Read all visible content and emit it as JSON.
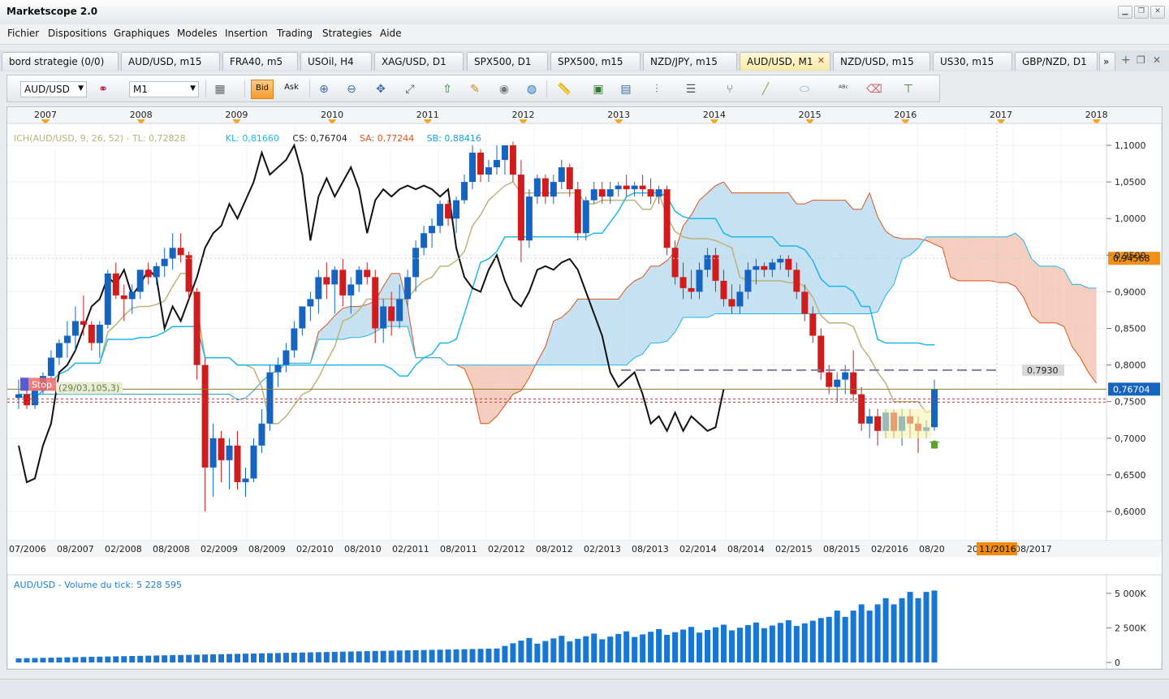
{
  "app": {
    "title": "Marketscope 2.0"
  },
  "window_buttons": [
    {
      "name": "minimize",
      "glyph": "▁"
    },
    {
      "name": "restore",
      "glyph": "❐"
    },
    {
      "name": "close",
      "glyph": "✕"
    }
  ],
  "menu": [
    "Fichier",
    "Dispositions",
    "Graphiques",
    "Modeles",
    "Insertion",
    "Trading",
    "Strategies",
    "Aide"
  ],
  "tabs": [
    {
      "label": "bord strategie (0/0)"
    },
    {
      "label": "AUD/USD, m15"
    },
    {
      "label": "FRA40, m5"
    },
    {
      "label": "USOil, H4"
    },
    {
      "label": "XAG/USD, D1"
    },
    {
      "label": "SPX500, D1"
    },
    {
      "label": "SPX500, m15"
    },
    {
      "label": "NZD/JPY, m15"
    },
    {
      "label": "AUD/USD, M1",
      "active": true
    },
    {
      "label": "NZD/USD, m15"
    },
    {
      "label": "US30, m15"
    },
    {
      "label": "GBP/NZD, D1"
    }
  ],
  "tab_controls": {
    "overflow": "»",
    "add": "+",
    "float": "❐",
    "close": "✕"
  },
  "toolbar": {
    "instrument": "AUD/USD",
    "timeframe": "M1",
    "bid_label": "Bid",
    "ask_label": "Ask",
    "icons": [
      "chart-type-icon",
      "crosshair-icon",
      "zoom-in-icon",
      "zoom-out-icon",
      "move-icon",
      "fit-icon",
      "cursor-icon",
      "properties-icon",
      "eye-icon",
      "globe-icon",
      "ruler-icon",
      "image-icon",
      "template-icon",
      "indicators-icon",
      "lines-icon",
      "pitchfork-icon",
      "pen-icon",
      "ellipse-icon",
      "text-icon",
      "eraser-icon",
      "hierarchy-icon"
    ]
  },
  "chart": {
    "top_years": [
      "2007",
      "2008",
      "2009",
      "2010",
      "2011",
      "2012",
      "2013",
      "2014",
      "2015",
      "2016",
      "2017",
      "2018"
    ],
    "indicator_header": [
      {
        "text": "ICH(AUD/USD, 9, 26, 52) -  TL: 0,72828",
        "color": "#b5b37a"
      },
      {
        "text": "KL: 0,81660",
        "color": "#1fb6e8"
      },
      {
        "text": "CS: 0,76704",
        "color": "#222222"
      },
      {
        "text": "SA: 0,77244",
        "color": "#d9541e"
      },
      {
        "text": "SB: 0,88416",
        "color": "#1a9fd6"
      }
    ],
    "price_ticks": [
      "1,1000",
      "1,0500",
      "1,0000",
      "0,9500",
      "0,9000",
      "0,8500",
      "0,8000",
      "0,7500",
      "0,7000",
      "0,6500",
      "0,6000"
    ],
    "current_price_label": "0,76704",
    "current_price": 0.76704,
    "marker_price_label": "0,94568",
    "marker_price": 0.94568,
    "level_label": "0.7930",
    "level_price": 0.793,
    "stop_label": "Stop",
    "stop_info": "(29/03,105,3)",
    "x_labels": [
      "07/2006",
      "08/2007",
      "02/2008",
      "08/2008",
      "02/2009",
      "08/2009",
      "02/2010",
      "08/2010",
      "02/2011",
      "08/2011",
      "02/2012",
      "08/2012",
      "02/2013",
      "08/2013",
      "02/2014",
      "08/2014",
      "02/2015",
      "08/2015",
      "02/2016",
      "08/20",
      "2017",
      "08/2017"
    ],
    "x_highlight": "11/2016",
    "volume_header": "AUD/USD - Volume du tick: 5 228 595",
    "volume_ticks": [
      "5 000K",
      "2 500K",
      "0"
    ],
    "colors": {
      "bull": "#1565c0",
      "bear": "#d01c1c",
      "kumo_bull": "#bcdcef",
      "kumo_bear": "#f3c6b4",
      "tenkan": "#bdb37a",
      "kijun": "#1fb6e8",
      "chikou": "#111111",
      "spanA": "#d9541e",
      "volume": "#1976d2",
      "price_flag": "#1565c0",
      "marker_flag": "#f0901a"
    }
  },
  "chart_data": {
    "type": "candlestick",
    "symbol": "AUD/USD",
    "timeframe": "M1",
    "x_range": [
      "07/2006",
      "08/2017"
    ],
    "ylim": [
      0.58,
      1.11
    ],
    "indicator": {
      "name": "ICH(AUD/USD, 9, 26, 52)",
      "TL": 0.72828,
      "KL": 0.8166,
      "CS": 0.76704,
      "SA": 0.77244,
      "SB": 0.88416
    },
    "candles": [
      [
        0.755,
        0.78,
        0.74,
        0.76
      ],
      [
        0.76,
        0.77,
        0.74,
        0.745
      ],
      [
        0.745,
        0.77,
        0.74,
        0.765
      ],
      [
        0.765,
        0.79,
        0.76,
        0.785
      ],
      [
        0.785,
        0.82,
        0.78,
        0.81
      ],
      [
        0.81,
        0.835,
        0.8,
        0.83
      ],
      [
        0.83,
        0.86,
        0.81,
        0.84
      ],
      [
        0.84,
        0.88,
        0.82,
        0.86
      ],
      [
        0.86,
        0.895,
        0.84,
        0.855
      ],
      [
        0.855,
        0.86,
        0.82,
        0.83
      ],
      [
        0.83,
        0.86,
        0.81,
        0.855
      ],
      [
        0.855,
        0.93,
        0.85,
        0.925
      ],
      [
        0.925,
        0.94,
        0.89,
        0.895
      ],
      [
        0.895,
        0.91,
        0.86,
        0.89
      ],
      [
        0.89,
        0.91,
        0.87,
        0.9
      ],
      [
        0.9,
        0.93,
        0.89,
        0.93
      ],
      [
        0.93,
        0.94,
        0.91,
        0.92
      ],
      [
        0.92,
        0.94,
        0.91,
        0.935
      ],
      [
        0.935,
        0.96,
        0.92,
        0.945
      ],
      [
        0.945,
        0.98,
        0.93,
        0.96
      ],
      [
        0.96,
        0.98,
        0.94,
        0.95
      ],
      [
        0.95,
        0.955,
        0.89,
        0.9
      ],
      [
        0.9,
        0.905,
        0.78,
        0.8
      ],
      [
        0.8,
        0.81,
        0.6,
        0.66
      ],
      [
        0.66,
        0.72,
        0.62,
        0.7
      ],
      [
        0.7,
        0.71,
        0.64,
        0.67
      ],
      [
        0.67,
        0.7,
        0.63,
        0.69
      ],
      [
        0.69,
        0.71,
        0.63,
        0.64
      ],
      [
        0.64,
        0.66,
        0.62,
        0.645
      ],
      [
        0.645,
        0.7,
        0.64,
        0.69
      ],
      [
        0.69,
        0.74,
        0.68,
        0.72
      ],
      [
        0.72,
        0.8,
        0.71,
        0.79
      ],
      [
        0.79,
        0.81,
        0.77,
        0.8
      ],
      [
        0.8,
        0.83,
        0.79,
        0.82
      ],
      [
        0.82,
        0.86,
        0.81,
        0.85
      ],
      [
        0.85,
        0.88,
        0.84,
        0.88
      ],
      [
        0.88,
        0.9,
        0.86,
        0.89
      ],
      [
        0.89,
        0.93,
        0.87,
        0.92
      ],
      [
        0.92,
        0.94,
        0.89,
        0.91
      ],
      [
        0.91,
        0.935,
        0.87,
        0.93
      ],
      [
        0.93,
        0.945,
        0.88,
        0.895
      ],
      [
        0.895,
        0.92,
        0.87,
        0.91
      ],
      [
        0.91,
        0.935,
        0.9,
        0.93
      ],
      [
        0.93,
        0.94,
        0.91,
        0.92
      ],
      [
        0.92,
        0.93,
        0.83,
        0.85
      ],
      [
        0.85,
        0.89,
        0.83,
        0.88
      ],
      [
        0.88,
        0.9,
        0.84,
        0.86
      ],
      [
        0.86,
        0.91,
        0.85,
        0.89
      ],
      [
        0.89,
        0.93,
        0.88,
        0.92
      ],
      [
        0.92,
        0.97,
        0.9,
        0.96
      ],
      [
        0.96,
        0.99,
        0.95,
        0.98
      ],
      [
        0.98,
        1.0,
        0.96,
        0.99
      ],
      [
        0.99,
        1.025,
        0.98,
        1.02
      ],
      [
        1.02,
        1.025,
        0.99,
        1.0
      ],
      [
        1.0,
        1.03,
        0.98,
        1.025
      ],
      [
        1.025,
        1.06,
        1.02,
        1.05
      ],
      [
        1.05,
        1.1,
        1.04,
        1.09
      ],
      [
        1.09,
        1.095,
        1.05,
        1.06
      ],
      [
        1.06,
        1.08,
        1.05,
        1.07
      ],
      [
        1.07,
        1.1,
        1.06,
        1.08
      ],
      [
        1.08,
        1.1,
        1.06,
        1.1
      ],
      [
        1.1,
        1.105,
        1.05,
        1.06
      ],
      [
        1.06,
        1.08,
        0.94,
        0.97
      ],
      [
        0.97,
        1.04,
        0.96,
        1.03
      ],
      [
        1.03,
        1.06,
        1.02,
        1.055
      ],
      [
        1.055,
        1.06,
        1.02,
        1.03
      ],
      [
        1.03,
        1.06,
        1.02,
        1.05
      ],
      [
        1.05,
        1.08,
        1.04,
        1.07
      ],
      [
        1.07,
        1.075,
        1.03,
        1.04
      ],
      [
        1.04,
        1.05,
        0.97,
        0.98
      ],
      [
        0.98,
        1.03,
        0.97,
        1.025
      ],
      [
        1.025,
        1.05,
        1.02,
        1.04
      ],
      [
        1.04,
        1.05,
        1.02,
        1.03
      ],
      [
        1.03,
        1.05,
        1.02,
        1.04
      ],
      [
        1.04,
        1.05,
        1.03,
        1.045
      ],
      [
        1.045,
        1.06,
        1.03,
        1.04
      ],
      [
        1.04,
        1.05,
        1.03,
        1.045
      ],
      [
        1.045,
        1.06,
        1.03,
        1.04
      ],
      [
        1.04,
        1.055,
        1.02,
        1.03
      ],
      [
        1.03,
        1.045,
        1.02,
        1.04
      ],
      [
        1.04,
        1.045,
        0.95,
        0.96
      ],
      [
        0.96,
        0.97,
        0.91,
        0.92
      ],
      [
        0.92,
        0.94,
        0.89,
        0.905
      ],
      [
        0.905,
        0.93,
        0.89,
        0.9
      ],
      [
        0.9,
        0.94,
        0.89,
        0.93
      ],
      [
        0.93,
        0.96,
        0.92,
        0.95
      ],
      [
        0.95,
        0.96,
        0.9,
        0.915
      ],
      [
        0.915,
        0.93,
        0.88,
        0.89
      ],
      [
        0.89,
        0.91,
        0.87,
        0.88
      ],
      [
        0.88,
        0.91,
        0.87,
        0.9
      ],
      [
        0.9,
        0.94,
        0.89,
        0.93
      ],
      [
        0.93,
        0.945,
        0.91,
        0.935
      ],
      [
        0.935,
        0.94,
        0.92,
        0.93
      ],
      [
        0.93,
        0.945,
        0.92,
        0.94
      ],
      [
        0.94,
        0.95,
        0.93,
        0.945
      ],
      [
        0.945,
        0.95,
        0.92,
        0.93
      ],
      [
        0.93,
        0.94,
        0.89,
        0.9
      ],
      [
        0.9,
        0.91,
        0.86,
        0.87
      ],
      [
        0.87,
        0.88,
        0.83,
        0.84
      ],
      [
        0.84,
        0.85,
        0.78,
        0.79
      ],
      [
        0.79,
        0.8,
        0.76,
        0.77
      ],
      [
        0.77,
        0.79,
        0.75,
        0.78
      ],
      [
        0.78,
        0.8,
        0.76,
        0.79
      ],
      [
        0.79,
        0.82,
        0.75,
        0.76
      ],
      [
        0.76,
        0.77,
        0.71,
        0.72
      ],
      [
        0.72,
        0.74,
        0.7,
        0.73
      ],
      [
        0.73,
        0.74,
        0.69,
        0.71
      ],
      [
        0.71,
        0.74,
        0.7,
        0.735
      ],
      [
        0.735,
        0.74,
        0.7,
        0.71
      ],
      [
        0.71,
        0.74,
        0.69,
        0.73
      ],
      [
        0.73,
        0.74,
        0.7,
        0.72
      ],
      [
        0.72,
        0.73,
        0.68,
        0.71
      ],
      [
        0.71,
        0.725,
        0.7,
        0.715
      ],
      [
        0.715,
        0.78,
        0.71,
        0.767
      ]
    ],
    "volume_ticks_max": 5000000
  },
  "status": {
    "text": ""
  }
}
